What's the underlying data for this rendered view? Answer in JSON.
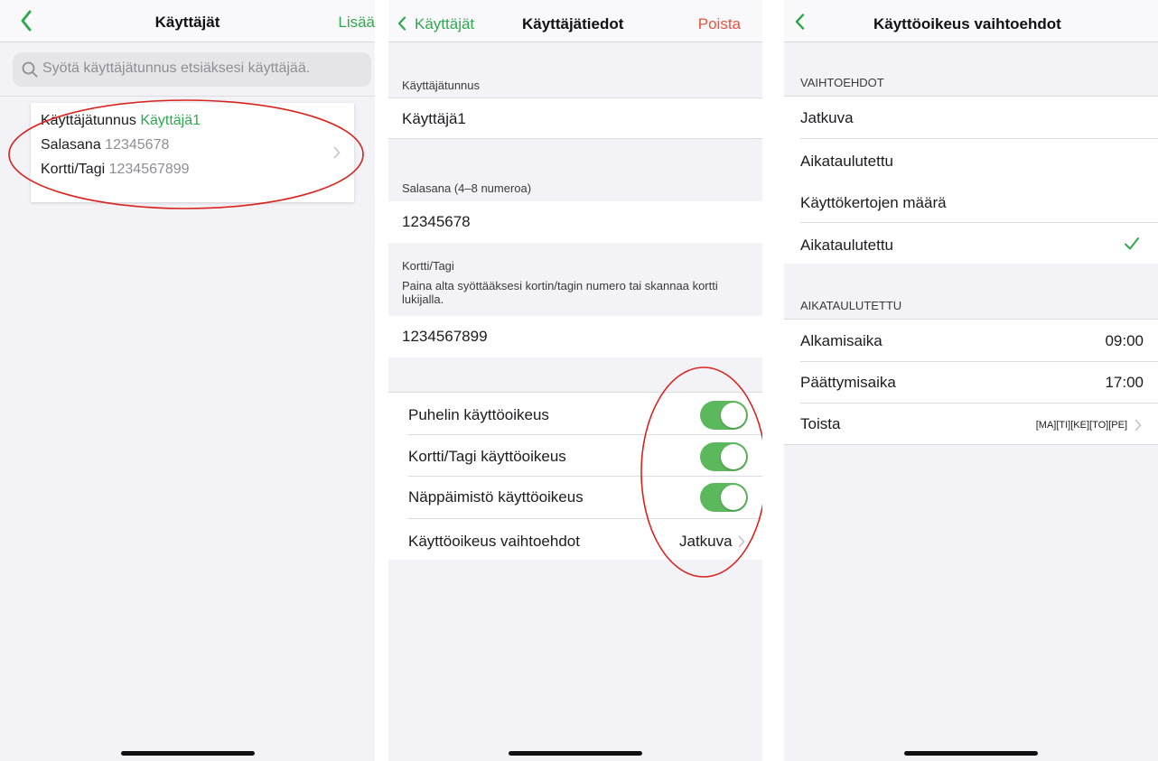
{
  "screen1": {
    "title": "Käyttäjät",
    "add_label": "Lisää",
    "search_placeholder": "Syötä käyttäjätunnus etsiäksesi käyttäjää.",
    "user_card": {
      "username_label": "Käyttäjätunnus",
      "username_value": "Käyttäjä1",
      "password_label": "Salasana",
      "password_value": "12345678",
      "card_label": "Kortti/Tagi",
      "card_value": "1234567899"
    }
  },
  "screen2": {
    "back_label": "Käyttäjät",
    "title": "Käyttäjätiedot",
    "delete_label": "Poista",
    "username_section": "Käyttäjätunnus",
    "username_value": "Käyttäjä1",
    "password_section": "Salasana (4–8 numeroa)",
    "password_value": "12345678",
    "card_section": "Kortti/Tagi",
    "card_hint": "Paina alta syöttääksesi kortin/tagin numero tai skannaa kortti lukijalla.",
    "card_value": "1234567899",
    "toggles": [
      {
        "label": "Puhelin käyttöoikeus",
        "on": true
      },
      {
        "label": "Kortti/Tagi käyttöoikeus",
        "on": true
      },
      {
        "label": "Näppäimistö käyttöoikeus",
        "on": true
      }
    ],
    "access_options_label": "Käyttöoikeus vaihtoehdot",
    "access_options_value": "Jatkuva"
  },
  "screen3": {
    "title": "Käyttöoikeus vaihtoehdot",
    "options_section": "VAIHTOEHDOT",
    "options": [
      "Jatkuva",
      "Aikataulutettu",
      "Käyttökertojen määrä",
      "Aikataulutettu"
    ],
    "scheduled_section": "AIKATAULUTETTU",
    "start_label": "Alkamisaika",
    "start_value": "09:00",
    "end_label": "Päättymisaika",
    "end_value": "17:00",
    "repeat_label": "Toista",
    "repeat_value": "[MA][TI][KE][TO][PE]"
  },
  "colors": {
    "accent_green": "#2fa84f",
    "toggle_green": "#5cb85c",
    "delete_red": "#e5533d",
    "annotation_red": "#d9231d"
  }
}
